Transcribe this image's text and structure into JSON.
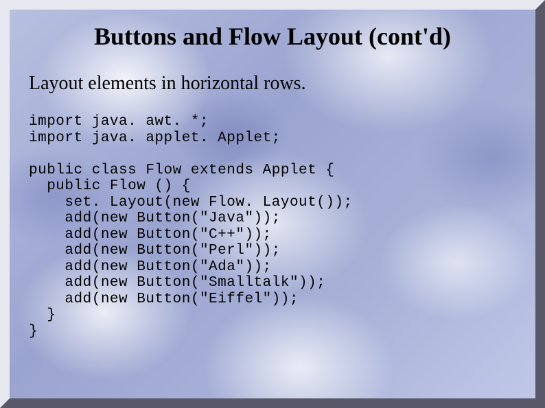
{
  "slide": {
    "title": "Buttons and Flow Layout (cont'd)",
    "subtitle": "Layout elements in horizontal rows.",
    "code": "import java. awt. *;\nimport java. applet. Applet;\n\npublic class Flow extends Applet {\n  public Flow () {\n    set. Layout(new Flow. Layout());\n    add(new Button(\"Java\"));\n    add(new Button(\"C++\"));\n    add(new Button(\"Perl\"));\n    add(new Button(\"Ada\"));\n    add(new Button(\"Smalltalk\"));\n    add(new Button(\"Eiffel\"));\n  }\n}"
  }
}
